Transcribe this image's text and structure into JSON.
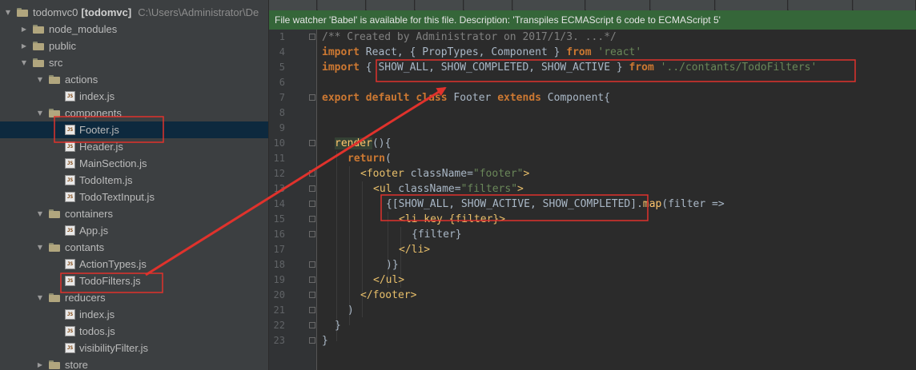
{
  "tree": {
    "root": {
      "name": "todomvc0",
      "project": "[todomvc]",
      "path": "C:\\Users\\Administrator\\De"
    },
    "items": [
      {
        "label": "node_modules",
        "type": "folder",
        "expanded": false
      },
      {
        "label": "public",
        "type": "folder",
        "expanded": false
      },
      {
        "label": "src",
        "type": "folder",
        "expanded": true
      },
      {
        "label": "actions",
        "type": "folder",
        "expanded": true
      },
      {
        "label": "index.js",
        "type": "file"
      },
      {
        "label": "components",
        "type": "folder",
        "expanded": true
      },
      {
        "label": "Footer.js",
        "type": "file",
        "selected": true
      },
      {
        "label": "Header.js",
        "type": "file"
      },
      {
        "label": "MainSection.js",
        "type": "file"
      },
      {
        "label": "TodoItem.js",
        "type": "file"
      },
      {
        "label": "TodoTextInput.js",
        "type": "file"
      },
      {
        "label": "containers",
        "type": "folder",
        "expanded": true
      },
      {
        "label": "App.js",
        "type": "file"
      },
      {
        "label": "contants",
        "type": "folder",
        "expanded": true
      },
      {
        "label": "ActionTypes.js",
        "type": "file"
      },
      {
        "label": "TodoFilters.js",
        "type": "file"
      },
      {
        "label": "reducers",
        "type": "folder",
        "expanded": true
      },
      {
        "label": "index.js",
        "type": "file"
      },
      {
        "label": "todos.js",
        "type": "file"
      },
      {
        "label": "visibilityFilter.js",
        "type": "file"
      },
      {
        "label": "store",
        "type": "folder",
        "expanded": false
      }
    ],
    "file_icon_text": "JS"
  },
  "editor": {
    "banner": "File watcher 'Babel' is available for this file. Description: 'Transpiles ECMAScript 6 code to ECMAScript 5'",
    "line_numbers": [
      "1",
      "4",
      "5",
      "6",
      "7",
      "8",
      "9",
      "10",
      "11",
      "12",
      "13",
      "14",
      "15",
      "16",
      "17",
      "18",
      "19",
      "20",
      "21",
      "22",
      "23"
    ],
    "tokens": {
      "import": "import",
      "from": "from",
      "export": "export",
      "default": "default",
      "class": "class",
      "extends": "extends",
      "return": "return",
      "comment": "/** Created by Administrator on 2017/1/3. ...*/",
      "line4_mid": " React, { PropTypes, Component } ",
      "react_str": "'react'",
      "line5_open": " { ",
      "line5_consts": "SHOW_ALL, SHOW_COMPLETED, SHOW_ACTIVE",
      "line5_close": " } ",
      "filters_path": "'../contants/TodoFilters'",
      "class_name": " Footer ",
      "component_open": " Component{",
      "render_name": "render",
      "render_rest": "(){",
      "return_rest": "(",
      "footer_open_tag": "<footer",
      "classname_attr": " className=",
      "footer_class_str": "\"footer\"",
      "gt": ">",
      "ul_open_tag": "<ul",
      "filters_class_str": "\"filters\"",
      "array_expr": "{[SHOW_ALL, SHOW_ACTIVE, SHOW_COMPLETED]",
      "dot": ".",
      "map_fn": "map",
      "map_rest": "(filter =>",
      "li_open": "<li key {filter}>",
      "filter_expr": "{filter}",
      "li_close": "</li>",
      "paren_brace": ")}",
      "ul_close": "</ul>",
      "footer_close": "</footer>",
      "paren": ")",
      "brace": "}"
    }
  },
  "annotation_color": "#e0322c"
}
